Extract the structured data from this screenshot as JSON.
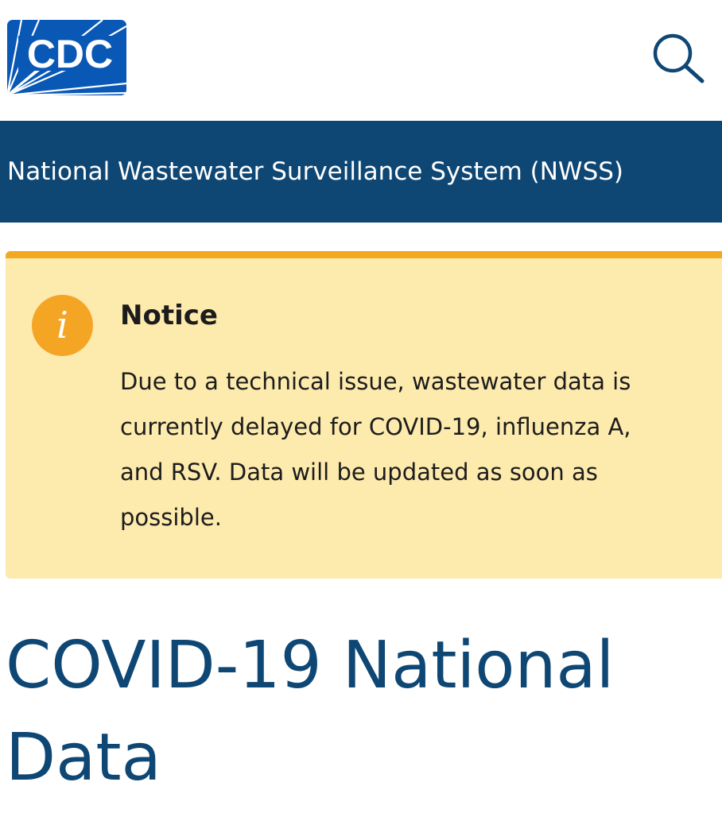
{
  "header": {
    "logo_text": "CDC",
    "logo_icon": "cdc-logo",
    "search_icon": "search-icon"
  },
  "site_banner": {
    "title": "National Wastewater Surveillance System (NWSS)"
  },
  "notice": {
    "icon": "info-icon",
    "icon_glyph": "i",
    "title": "Notice",
    "body_lines": [
      "Due to a technical issue, wastewater data is",
      "currently delayed for COVID-19, influenza A,",
      "and RSV. Data will be updated as soon as",
      "possible."
    ]
  },
  "page": {
    "title_lines": [
      "COVID-19 National",
      "Data"
    ]
  },
  "colors": {
    "brand_blue": "#0f4774",
    "logo_blue": "#0a58b5",
    "notice_bg": "#fdeaad",
    "notice_border": "#f2a81f",
    "info_icon": "#f5a524"
  }
}
